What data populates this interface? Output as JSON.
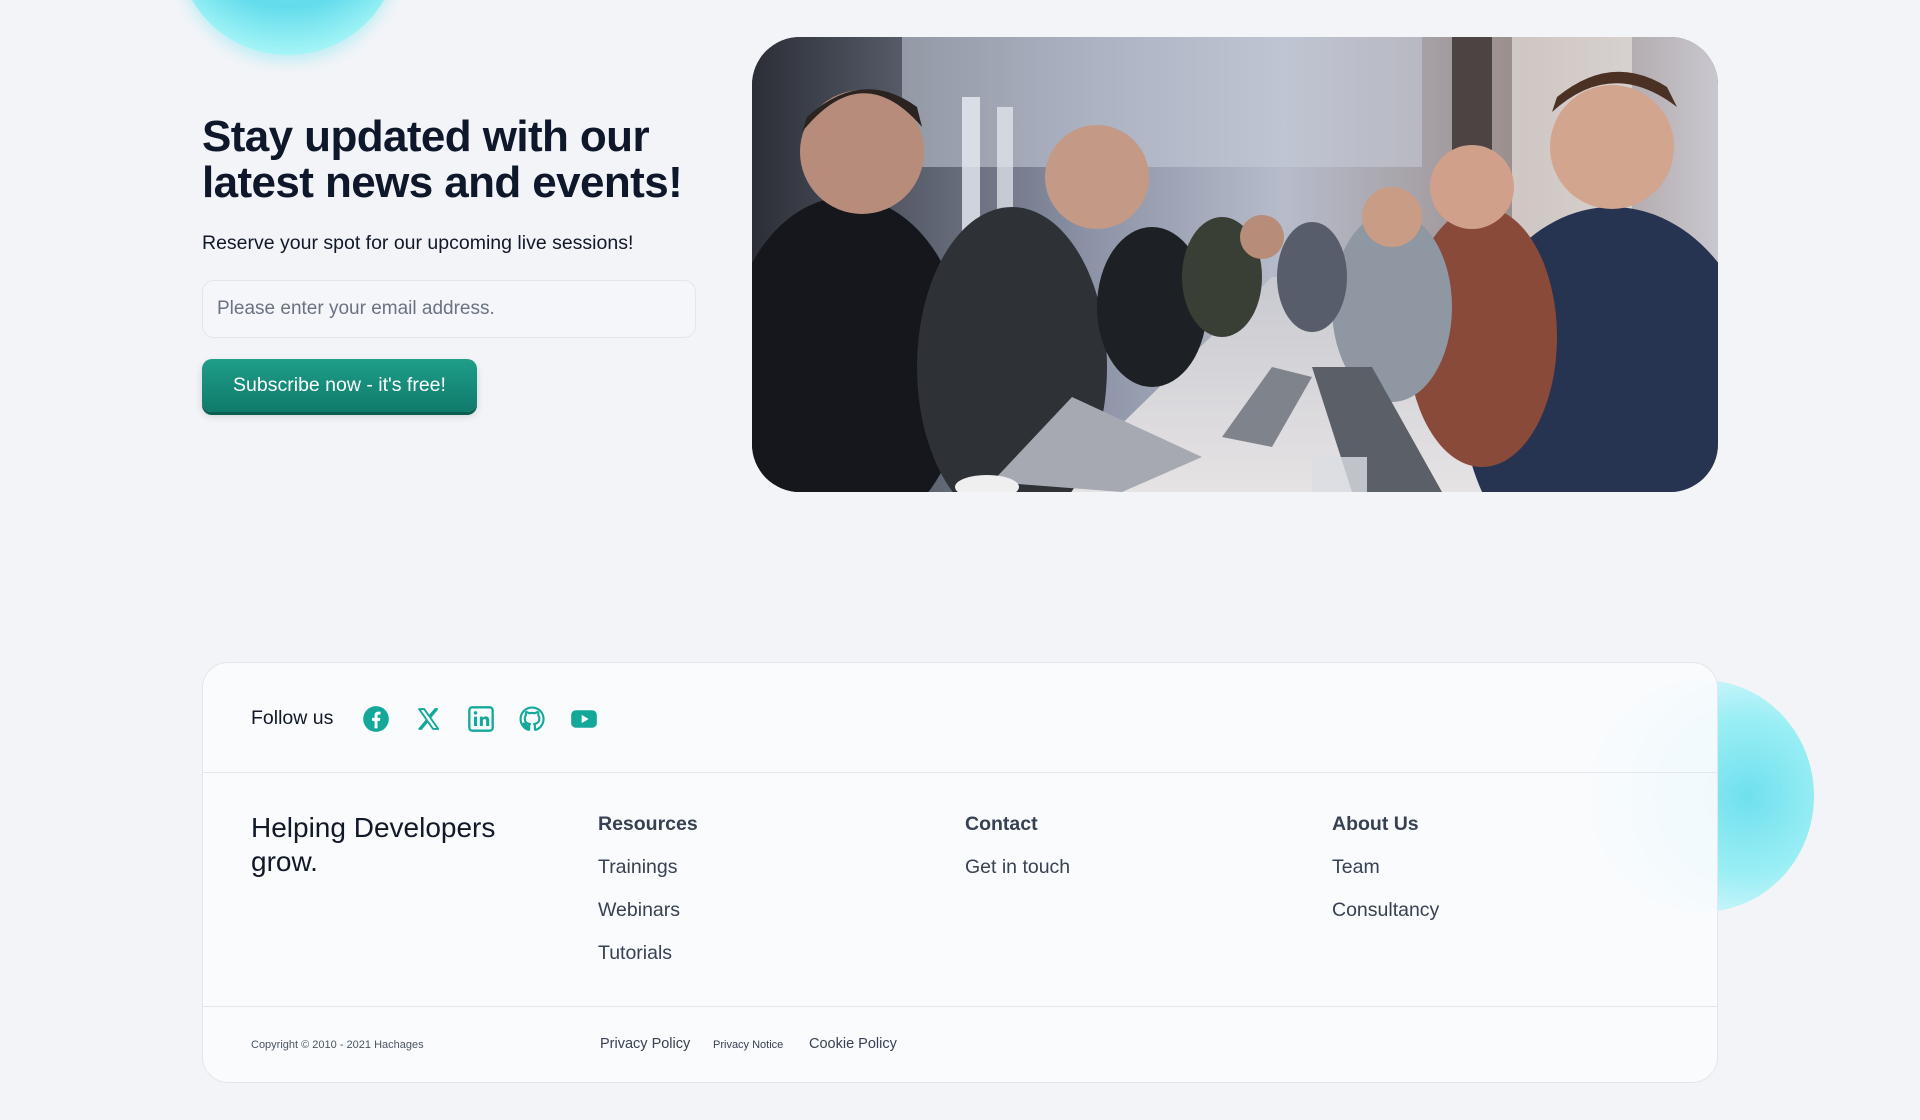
{
  "hero": {
    "title": "Stay updated with our latest news and events!",
    "subtitle": "Reserve your spot for our upcoming live sessions!",
    "email_placeholder": "Please enter your email address.",
    "subscribe_label": "Subscribe now - it's free!"
  },
  "footer": {
    "follow_label": "Follow us",
    "social_icons": [
      "facebook-icon",
      "x-icon",
      "linkedin-icon",
      "github-icon",
      "youtube-icon"
    ],
    "tagline": "Helping Developers grow.",
    "columns": [
      {
        "heading": "Resources",
        "links": [
          "Trainings",
          "Webinars",
          "Tutorials"
        ]
      },
      {
        "heading": "Contact",
        "links": [
          "Get in touch"
        ]
      },
      {
        "heading": "About Us",
        "links": [
          "Team",
          "Consultancy"
        ]
      }
    ],
    "copyright": "Copyright © 2010 - 2021 Hachages",
    "legal": {
      "privacy_policy": "Privacy Policy",
      "privacy_notice": "Privacy Notice",
      "cookie_policy": "Cookie Policy"
    }
  },
  "colors": {
    "accent": "#14a89a",
    "button": "#117f6f",
    "background": "#f2f4f8",
    "bubble": "#6fe0ee"
  }
}
